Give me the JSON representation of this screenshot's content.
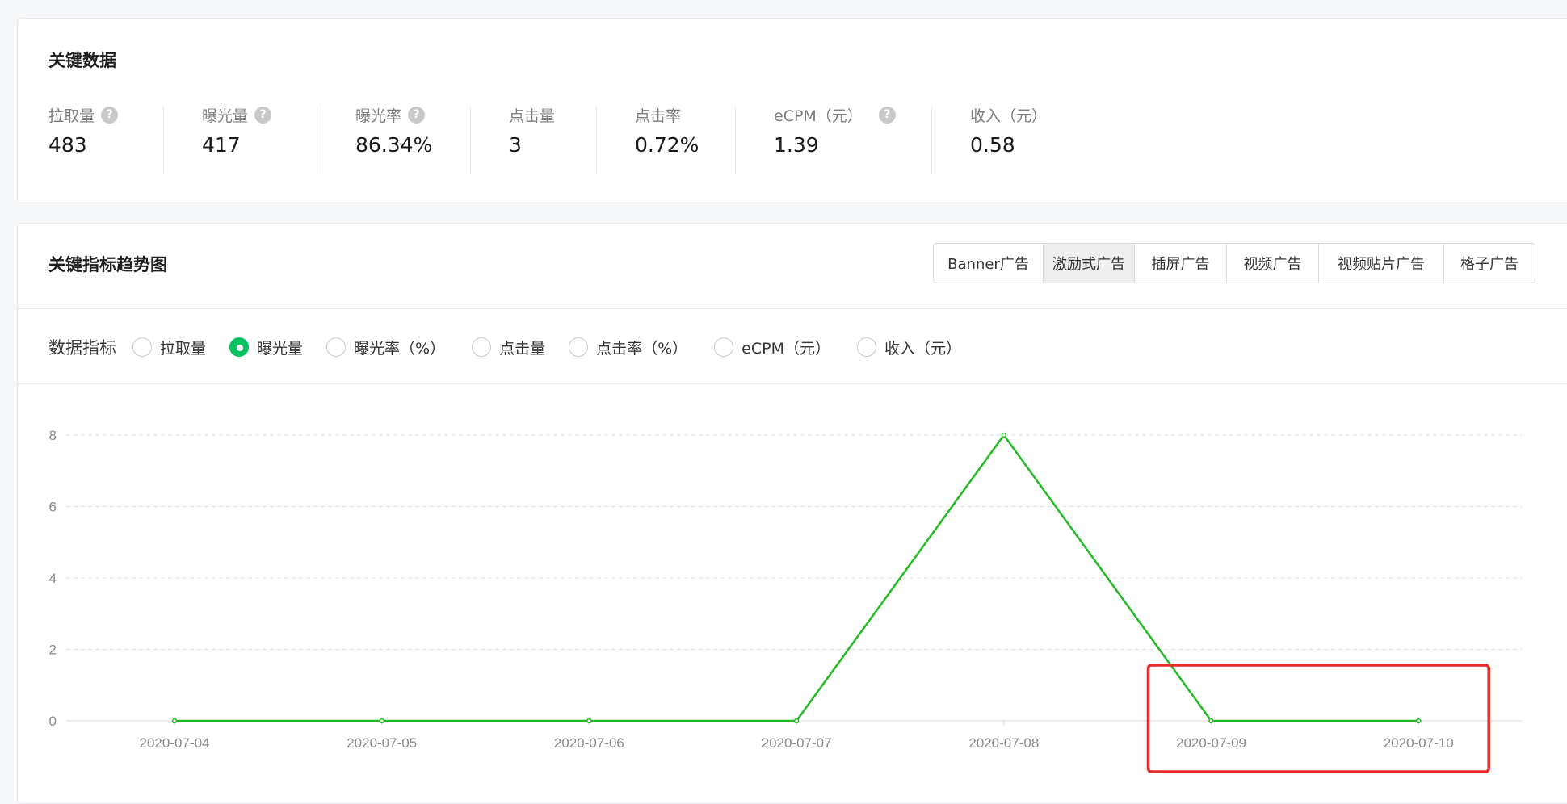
{
  "key_data": {
    "title": "关键数据",
    "metrics": [
      {
        "label": "拉取量",
        "value": "483",
        "help": true
      },
      {
        "label": "曝光量",
        "value": "417",
        "help": true
      },
      {
        "label": "曝光率",
        "value": "86.34%",
        "help": true
      },
      {
        "label": "点击量",
        "value": "3",
        "help": false
      },
      {
        "label": "点击率",
        "value": "0.72%",
        "help": false
      },
      {
        "label": "eCPM（元）",
        "value": "1.39",
        "help": true
      },
      {
        "label": "收入（元）",
        "value": "0.58",
        "help": false
      }
    ],
    "help_glyph": "?"
  },
  "trend": {
    "title": "关键指标趋势图",
    "tabs": [
      "Banner广告",
      "激励式广告",
      "插屏广告",
      "视频广告",
      "视频贴片广告",
      "格子广告"
    ],
    "active_tab": "激励式广告",
    "picker_label": "数据指标",
    "options": [
      "拉取量",
      "曝光量",
      "曝光率（%）",
      "点击量",
      "点击率（%）",
      "eCPM（元）",
      "收入（元）"
    ],
    "selected_option": "曝光量"
  },
  "colors": {
    "accent": "#07c160",
    "line": "#22b924",
    "highlight_box": "#e82a2a",
    "grid": "#dfe0e3"
  },
  "chart_data": {
    "type": "line",
    "categories": [
      "2020-07-04",
      "2020-07-05",
      "2020-07-06",
      "2020-07-07",
      "2020-07-08",
      "2020-07-09",
      "2020-07-10"
    ],
    "series": [
      {
        "values": [
          0,
          0,
          0,
          0,
          8,
          0,
          0
        ]
      }
    ],
    "y_ticks": [
      0,
      2,
      4,
      6,
      8
    ],
    "ylim": [
      0,
      8
    ],
    "grid": true,
    "annotation": {
      "type": "highlight-box",
      "categories": [
        "2020-07-09",
        "2020-07-10"
      ]
    }
  }
}
